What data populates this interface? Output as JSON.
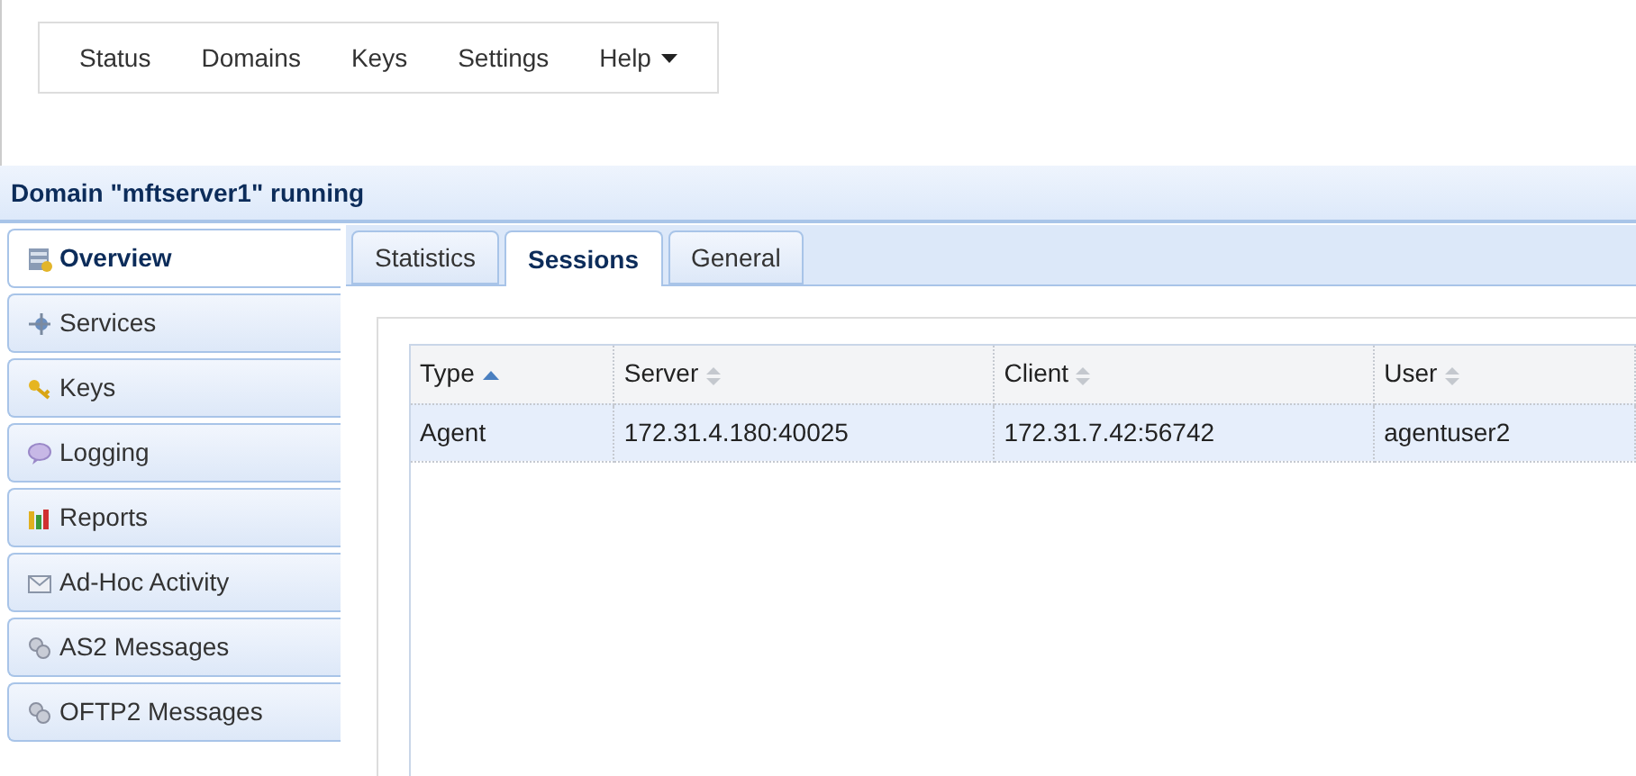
{
  "nav": [
    {
      "label": "Status",
      "dropdown": false
    },
    {
      "label": "Domains",
      "dropdown": false
    },
    {
      "label": "Keys",
      "dropdown": false
    },
    {
      "label": "Settings",
      "dropdown": false
    },
    {
      "label": "Help",
      "dropdown": true
    }
  ],
  "header": {
    "title": "Domain \"mftserver1\" running"
  },
  "sidebar": {
    "items": [
      {
        "label": "Overview",
        "selected": true
      },
      {
        "label": "Services",
        "selected": false
      },
      {
        "label": "Keys",
        "selected": false
      },
      {
        "label": "Logging",
        "selected": false
      },
      {
        "label": "Reports",
        "selected": false
      },
      {
        "label": "Ad-Hoc Activity",
        "selected": false
      },
      {
        "label": "AS2 Messages",
        "selected": false
      },
      {
        "label": "OFTP2 Messages",
        "selected": false
      }
    ]
  },
  "tabs": [
    {
      "label": "Statistics",
      "selected": false
    },
    {
      "label": "Sessions",
      "selected": true
    },
    {
      "label": "General",
      "selected": false
    }
  ],
  "table": {
    "columns": [
      {
        "label": "Type",
        "sorted": true
      },
      {
        "label": "Server",
        "sorted": false
      },
      {
        "label": "Client",
        "sorted": false
      },
      {
        "label": "User",
        "sorted": false
      }
    ],
    "rows": [
      {
        "cells": [
          "Agent",
          "172.31.4.180:40025",
          "172.31.7.42:56742",
          "agentuser2"
        ],
        "selected": true
      }
    ]
  }
}
